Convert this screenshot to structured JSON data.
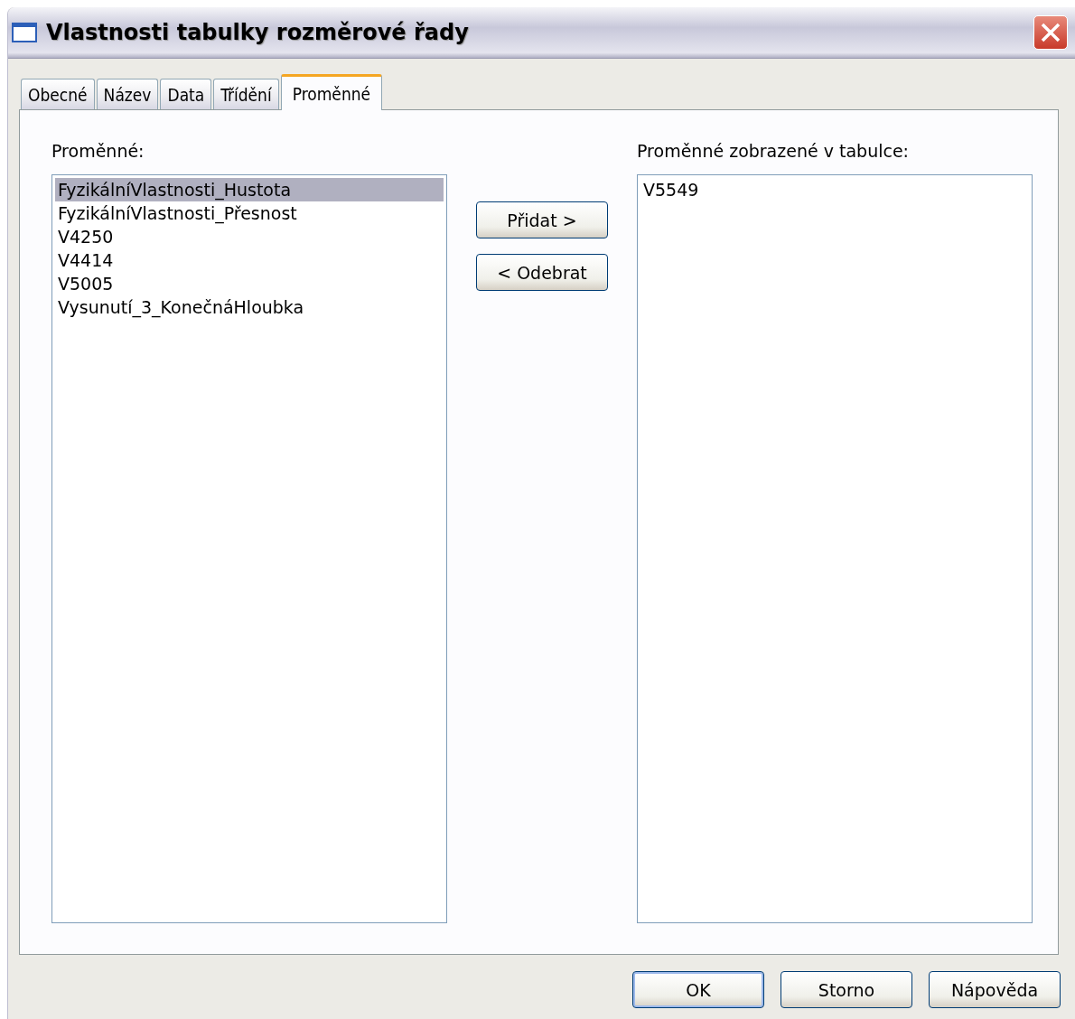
{
  "window": {
    "title": "Vlastnosti tabulky rozměrové řady"
  },
  "tabs": [
    {
      "label": "Obecné",
      "selected": false
    },
    {
      "label": "Název",
      "selected": false
    },
    {
      "label": "Data",
      "selected": false
    },
    {
      "label": "Třídění",
      "selected": false
    },
    {
      "label": "Proměnné",
      "selected": true
    }
  ],
  "available": {
    "label": "Proměnné:",
    "items": [
      {
        "text": "FyzikálníVlastnosti_Hustota",
        "selected": true
      },
      {
        "text": "FyzikálníVlastnosti_Přesnost",
        "selected": false
      },
      {
        "text": "V4250",
        "selected": false
      },
      {
        "text": "V4414",
        "selected": false
      },
      {
        "text": "V5005",
        "selected": false
      },
      {
        "text": "Vysunutí_3_KonečnáHloubka",
        "selected": false
      }
    ]
  },
  "move_buttons": [
    "Přidat >",
    "< Odebrat"
  ],
  "shown": {
    "label": "Proměnné zobrazené v tabulce:",
    "items": [
      {
        "text": "V5549",
        "selected": false
      }
    ]
  },
  "buttons": [
    {
      "label": "OK",
      "default": true
    },
    {
      "label": "Storno",
      "default": false
    },
    {
      "label": "Nápověda",
      "default": false
    }
  ]
}
